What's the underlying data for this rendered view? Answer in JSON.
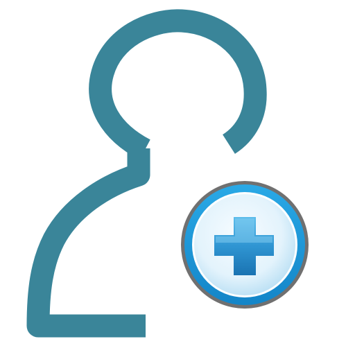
{
  "icon": {
    "name": "add-user",
    "colors": {
      "person_outline": "#3A8599",
      "badge_ring_gray": "#6F6F6F",
      "badge_ring_blue": "#1E9FDB",
      "badge_fill_light": "#F2FAFF",
      "badge_fill_mid": "#CFEAF8",
      "plus_light": "#56B7E8",
      "plus_dark": "#1B78B6",
      "background": "#FFFFFF"
    }
  }
}
